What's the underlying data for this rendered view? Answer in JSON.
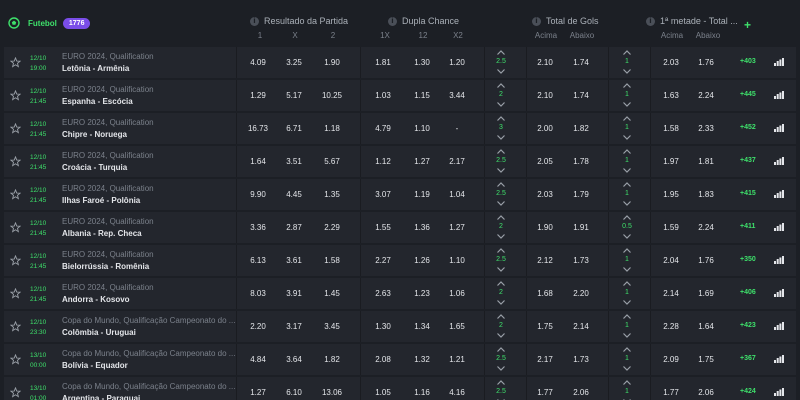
{
  "header": {
    "sport_label": "Futebol",
    "event_count": "1776",
    "groups": [
      {
        "title": "Resultado da Partida",
        "subs": [
          "1",
          "X",
          "2"
        ]
      },
      {
        "title": "Dupla Chance",
        "subs": [
          "1X",
          "12",
          "X2"
        ]
      },
      {
        "title": "Total de Gols",
        "subs": [
          "Acima",
          "Abaixo"
        ]
      },
      {
        "title": "1ª metade - Total ...",
        "subs": [
          "Acima",
          "Abaixo"
        ]
      }
    ],
    "plus_label": "+"
  },
  "matches": [
    {
      "date": "12/10",
      "time": "19:00",
      "league": "EURO 2024, Qualification",
      "home": "Letônia",
      "away": "Armênia",
      "r1": "4.09",
      "rx": "3.25",
      "r2": "1.90",
      "d1x": "1.81",
      "d12": "1.30",
      "dx2": "1.20",
      "tline": "2.5",
      "tover": "2.10",
      "tunder": "1.74",
      "hline": "1",
      "hover": "2.03",
      "hunder": "1.76",
      "more": "+403"
    },
    {
      "date": "12/10",
      "time": "21:45",
      "league": "EURO 2024, Qualification",
      "home": "Espanha",
      "away": "Escócia",
      "r1": "1.29",
      "rx": "5.17",
      "r2": "10.25",
      "d1x": "1.03",
      "d12": "1.15",
      "dx2": "3.44",
      "tline": "2",
      "tover": "2.10",
      "tunder": "1.74",
      "hline": "1",
      "hover": "1.63",
      "hunder": "2.24",
      "more": "+445"
    },
    {
      "date": "12/10",
      "time": "21:45",
      "league": "EURO 2024, Qualification",
      "home": "Chipre",
      "away": "Noruega",
      "r1": "16.73",
      "rx": "6.71",
      "r2": "1.18",
      "d1x": "4.79",
      "d12": "1.10",
      "dx2": "-",
      "tline": "3",
      "tover": "2.00",
      "tunder": "1.82",
      "hline": "1",
      "hover": "1.58",
      "hunder": "2.33",
      "more": "+452"
    },
    {
      "date": "12/10",
      "time": "21:45",
      "league": "EURO 2024, Qualification",
      "home": "Croácia",
      "away": "Turquia",
      "r1": "1.64",
      "rx": "3.51",
      "r2": "5.67",
      "d1x": "1.12",
      "d12": "1.27",
      "dx2": "2.17",
      "tline": "2.5",
      "tover": "2.05",
      "tunder": "1.78",
      "hline": "1",
      "hover": "1.97",
      "hunder": "1.81",
      "more": "+437"
    },
    {
      "date": "12/10",
      "time": "21:45",
      "league": "EURO 2024, Qualification",
      "home": "Ilhas Faroé",
      "away": "Polônia",
      "r1": "9.90",
      "rx": "4.45",
      "r2": "1.35",
      "d1x": "3.07",
      "d12": "1.19",
      "dx2": "1.04",
      "tline": "2.5",
      "tover": "2.03",
      "tunder": "1.79",
      "hline": "1",
      "hover": "1.95",
      "hunder": "1.83",
      "more": "+415"
    },
    {
      "date": "12/10",
      "time": "21:45",
      "league": "EURO 2024, Qualification",
      "home": "Albania",
      "away": "Rep. Checa",
      "r1": "3.36",
      "rx": "2.87",
      "r2": "2.29",
      "d1x": "1.55",
      "d12": "1.36",
      "dx2": "1.27",
      "tline": "2",
      "tover": "1.90",
      "tunder": "1.91",
      "hline": "0.5",
      "hover": "1.59",
      "hunder": "2.24",
      "more": "+411"
    },
    {
      "date": "12/10",
      "time": "21:45",
      "league": "EURO 2024, Qualification",
      "home": "Bielorrússia",
      "away": "Romênia",
      "r1": "6.13",
      "rx": "3.61",
      "r2": "1.58",
      "d1x": "2.27",
      "d12": "1.26",
      "dx2": "1.10",
      "tline": "2.5",
      "tover": "2.12",
      "tunder": "1.73",
      "hline": "1",
      "hover": "2.04",
      "hunder": "1.76",
      "more": "+350"
    },
    {
      "date": "12/10",
      "time": "21:45",
      "league": "EURO 2024, Qualification",
      "home": "Andorra",
      "away": "Kosovo",
      "r1": "8.03",
      "rx": "3.91",
      "r2": "1.45",
      "d1x": "2.63",
      "d12": "1.23",
      "dx2": "1.06",
      "tline": "2",
      "tover": "1.68",
      "tunder": "2.20",
      "hline": "1",
      "hover": "2.14",
      "hunder": "1.69",
      "more": "+406"
    },
    {
      "date": "12/10",
      "time": "23:30",
      "league": "Copa do Mundo, Qualificação Campeonato do ...",
      "home": "Colômbia",
      "away": "Uruguai",
      "r1": "2.20",
      "rx": "3.17",
      "r2": "3.45",
      "d1x": "1.30",
      "d12": "1.34",
      "dx2": "1.65",
      "tline": "2",
      "tover": "1.75",
      "tunder": "2.14",
      "hline": "1",
      "hover": "2.28",
      "hunder": "1.64",
      "more": "+423"
    },
    {
      "date": "13/10",
      "time": "00:00",
      "league": "Copa do Mundo, Qualificação Campeonato do ...",
      "home": "Bolívia",
      "away": "Equador",
      "r1": "4.84",
      "rx": "3.64",
      "r2": "1.82",
      "d1x": "2.08",
      "d12": "1.32",
      "dx2": "1.21",
      "tline": "2.5",
      "tover": "2.17",
      "tunder": "1.73",
      "hline": "1",
      "hover": "2.09",
      "hunder": "1.75",
      "more": "+367"
    },
    {
      "date": "13/10",
      "time": "01:00",
      "league": "Copa do Mundo, Qualificação Campeonato do ...",
      "home": "Argentina",
      "away": "Paraguai",
      "r1": "1.27",
      "rx": "6.10",
      "r2": "13.06",
      "d1x": "1.05",
      "d12": "1.16",
      "dx2": "4.16",
      "tline": "2.5",
      "tover": "1.77",
      "tunder": "2.06",
      "hline": "1",
      "hover": "1.77",
      "hunder": "2.06",
      "more": "+424"
    }
  ],
  "colors": {
    "accent": "#3ee06b",
    "badge": "#7a4de8",
    "row": "#23262d",
    "bg": "#1c1f25"
  }
}
